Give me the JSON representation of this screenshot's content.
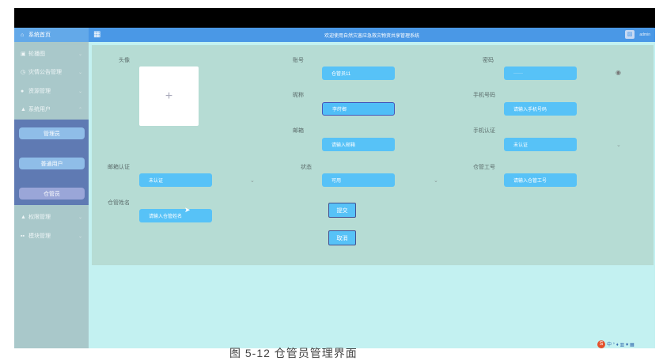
{
  "sidebar": {
    "items": [
      {
        "label": "系统首页",
        "icon": "home-icon",
        "glyph": "⌂"
      },
      {
        "label": "轮播图",
        "icon": "image-icon",
        "glyph": "▣"
      },
      {
        "label": "灾情公告管理",
        "icon": "clock-icon",
        "glyph": "◷"
      },
      {
        "label": "资源管理",
        "icon": "pin-icon",
        "glyph": "●"
      },
      {
        "label": "系统用户",
        "icon": "user-icon",
        "glyph": "▲"
      },
      {
        "label": "权限管理",
        "icon": "user-icon",
        "glyph": "▲"
      },
      {
        "label": "模块管理",
        "icon": "grid-icon",
        "glyph": "▪▪"
      }
    ],
    "sub_items": [
      "管理员",
      "普通用户",
      "仓管员"
    ]
  },
  "header": {
    "title": "欢迎使用自然灾害应急救灾物资共享管理系统",
    "user": "admin"
  },
  "form": {
    "avatar_label": "头像",
    "upload_plus": "+",
    "account": {
      "label": "账号",
      "value": "仓管员11"
    },
    "password": {
      "label": "密码",
      "value": "······"
    },
    "nickname": {
      "label": "昵称",
      "value": "李莳榔"
    },
    "phone": {
      "label": "手机号码",
      "placeholder": "请输入手机号码"
    },
    "email": {
      "label": "邮箱",
      "placeholder": "请输入邮箱"
    },
    "phone_verify": {
      "label": "手机认证",
      "value": "未认证"
    },
    "email_verify": {
      "label": "邮箱认证",
      "value": "未认证"
    },
    "status": {
      "label": "状态",
      "value": "可用"
    },
    "staff_no": {
      "label": "仓管工号",
      "placeholder": "请输入仓管工号"
    },
    "staff_name": {
      "label": "仓管姓名",
      "placeholder": "请输入仓管姓名"
    },
    "submit": "提交",
    "cancel": "取消"
  },
  "caption": "图 5-12 仓管员管理界面"
}
